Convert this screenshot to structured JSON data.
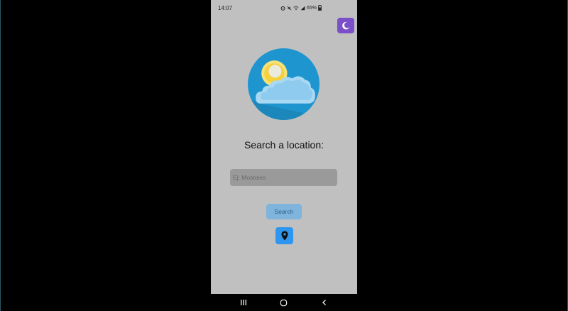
{
  "status_bar": {
    "time": "14:07",
    "battery": "65%",
    "icons": [
      "alarm-icon",
      "mute-icon",
      "wifi-icon",
      "signal-icon",
      "battery-icon"
    ]
  },
  "header": {
    "theme_toggle_icon": "moon-icon"
  },
  "logo": {
    "icon": "sun-cloud-icon"
  },
  "search": {
    "prompt": "Search a location:",
    "placeholder": "Ej: Mostoles",
    "value": "",
    "button_label": "Search",
    "geolocation_icon": "location-pin-icon"
  },
  "navigation_bar": {
    "items": [
      "recents-icon",
      "home-icon",
      "back-icon"
    ]
  },
  "colors": {
    "app_background": "#c0c0c0",
    "theme_button": "#7a4fc8",
    "search_button": "#7fb4dc",
    "search_button_text": "#2c5f8a",
    "geo_button": "#2e96ee",
    "input_background": "#9a9a9a",
    "logo_circle": "#1f95cf"
  }
}
